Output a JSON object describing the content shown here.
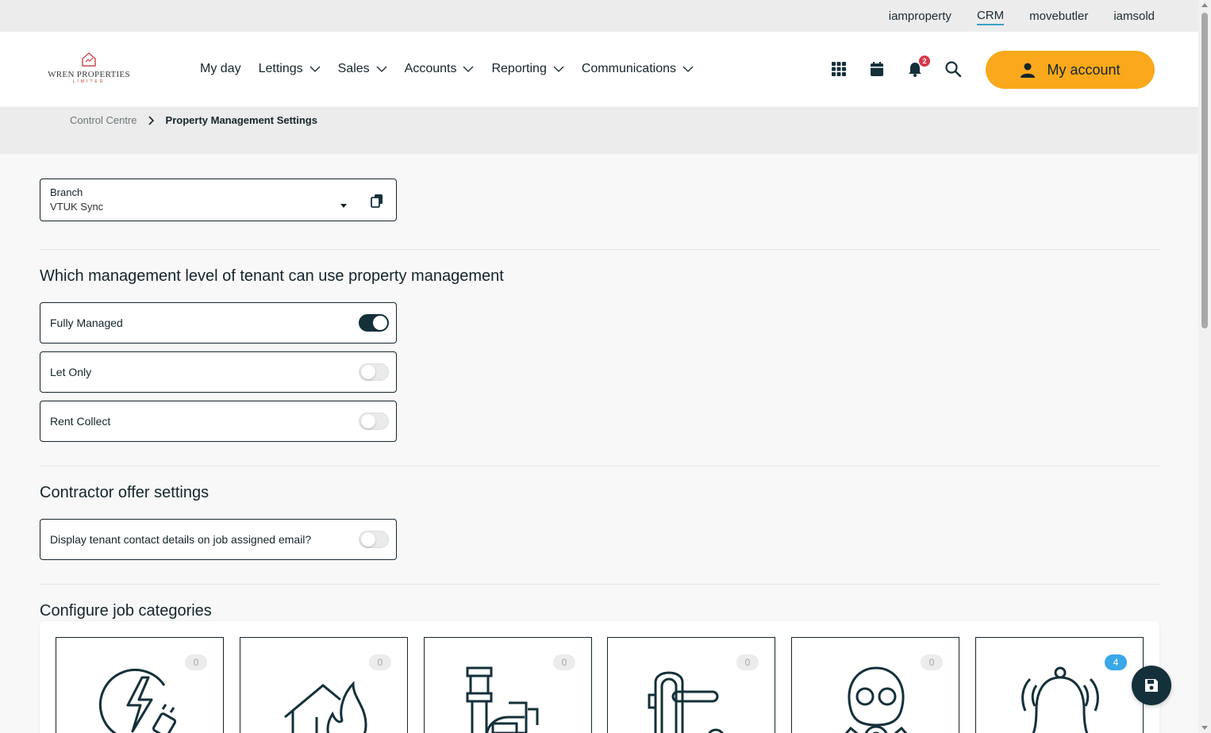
{
  "topbar": {
    "links": [
      "iamproperty",
      "CRM",
      "movebutler",
      "iamsold"
    ],
    "active": "CRM"
  },
  "logo": {
    "name": "WREN PROPERTIES",
    "sub": "LIMITED"
  },
  "nav": {
    "items": [
      "My day",
      "Lettings",
      "Sales",
      "Accounts",
      "Reporting",
      "Communications"
    ],
    "notification_count": "2",
    "account_label": "My account"
  },
  "breadcrumb": {
    "parent": "Control Centre",
    "current": "Property Management Settings"
  },
  "branch": {
    "label": "Branch",
    "value": "VTUK Sync"
  },
  "management": {
    "heading": "Which management level of tenant can use property management",
    "options": [
      {
        "label": "Fully Managed",
        "on": true
      },
      {
        "label": "Let Only",
        "on": false
      },
      {
        "label": "Rent Collect",
        "on": false
      }
    ]
  },
  "contractor": {
    "heading": "Contractor offer settings",
    "options": [
      {
        "label": "Display tenant contact details on job assigned email?",
        "on": false
      }
    ]
  },
  "categories": {
    "heading": "Configure job categories",
    "counts": [
      "0",
      "0",
      "0",
      "0",
      "0",
      "4"
    ],
    "icons": [
      "electrical-icon",
      "fire-icon",
      "plumbing-icon",
      "door-lock-icon",
      "gas-mask-icon",
      "alarm-bell-icon"
    ]
  },
  "colors": {
    "accent": "#f9a91b",
    "dark": "#14303a",
    "badge_blue": "#3aa7e8"
  }
}
